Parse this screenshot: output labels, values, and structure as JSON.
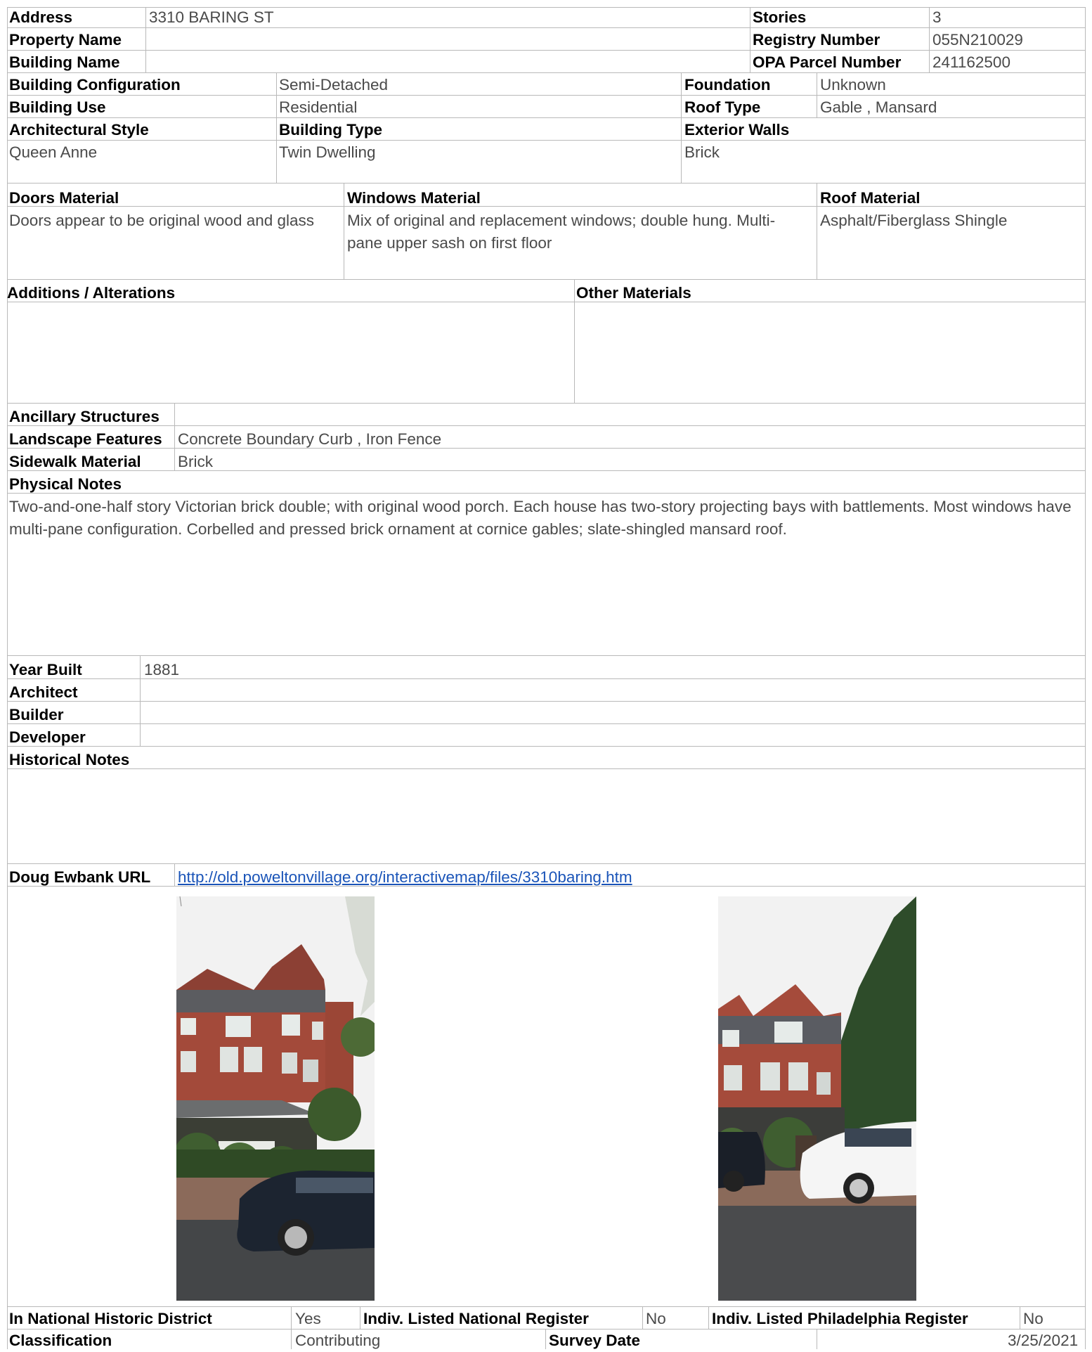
{
  "header": {
    "address_label": "Address",
    "address": "3310 BARING ST",
    "stories_label": "Stories",
    "stories": "3",
    "property_name_label": "Property Name",
    "property_name": "",
    "registry_label": "Registry Number",
    "registry": "055N210029",
    "building_name_label": "Building Name",
    "building_name": "",
    "opa_label": "OPA Parcel Number",
    "opa": "241162500"
  },
  "building": {
    "config_label": "Building Configuration",
    "config": "Semi-Detached",
    "foundation_label": "Foundation",
    "foundation": "Unknown",
    "use_label": "Building Use",
    "use": "Residential",
    "roof_type_label": "Roof Type",
    "roof_type": "Gable , Mansard",
    "style_label": "Architectural Style",
    "style": "Queen Anne",
    "type_label": "Building Type",
    "type": "Twin Dwelling",
    "walls_label": "Exterior Walls",
    "walls": "Brick"
  },
  "materials": {
    "doors_label": "Doors Material",
    "doors": "Doors appear to be original wood and glass",
    "windows_label": "Windows Material",
    "windows": "Mix of original and replacement windows; double hung. Multi-pane upper sash on first floor",
    "roof_label": "Roof Material",
    "roof": "Asphalt/Fiberglass Shingle",
    "additions_label": "Additions / Alterations",
    "additions": "",
    "other_label": "Other Materials",
    "other": ""
  },
  "site": {
    "ancillary_label": "Ancillary Structures",
    "ancillary": "",
    "landscape_label": "Landscape Features",
    "landscape": "Concrete Boundary Curb , Iron Fence",
    "sidewalk_label": "Sidewalk Material",
    "sidewalk": "Brick"
  },
  "physical_notes": {
    "label": "Physical Notes",
    "text": "Two-and-one-half story Victorian brick double; with original wood porch. Each house has two-story projecting bays with battlements. Most windows have multi-pane configuration. Corbelled and pressed brick ornament at cornice gables; slate-shingled mansard roof."
  },
  "history": {
    "year_label": "Year Built",
    "year": "1881",
    "architect_label": "Architect",
    "architect": "",
    "builder_label": "Builder",
    "builder": "",
    "developer_label": "Developer",
    "developer": "",
    "notes_label": "Historical Notes",
    "notes": ""
  },
  "url": {
    "label": "Doug Ewbank URL",
    "value": "http://old.poweltonvillage.org/interactivemap/files/3310baring.htm"
  },
  "footer": {
    "district_label": "In National Historic District",
    "district": "Yes",
    "national_label": "Indiv. Listed National Register",
    "national": "No",
    "phila_label": "Indiv. Listed Philadelphia Register",
    "phila": "No",
    "class_label": "Classification",
    "class": "Contributing",
    "survey_label": "Survey Date",
    "survey": "3/25/2021"
  }
}
